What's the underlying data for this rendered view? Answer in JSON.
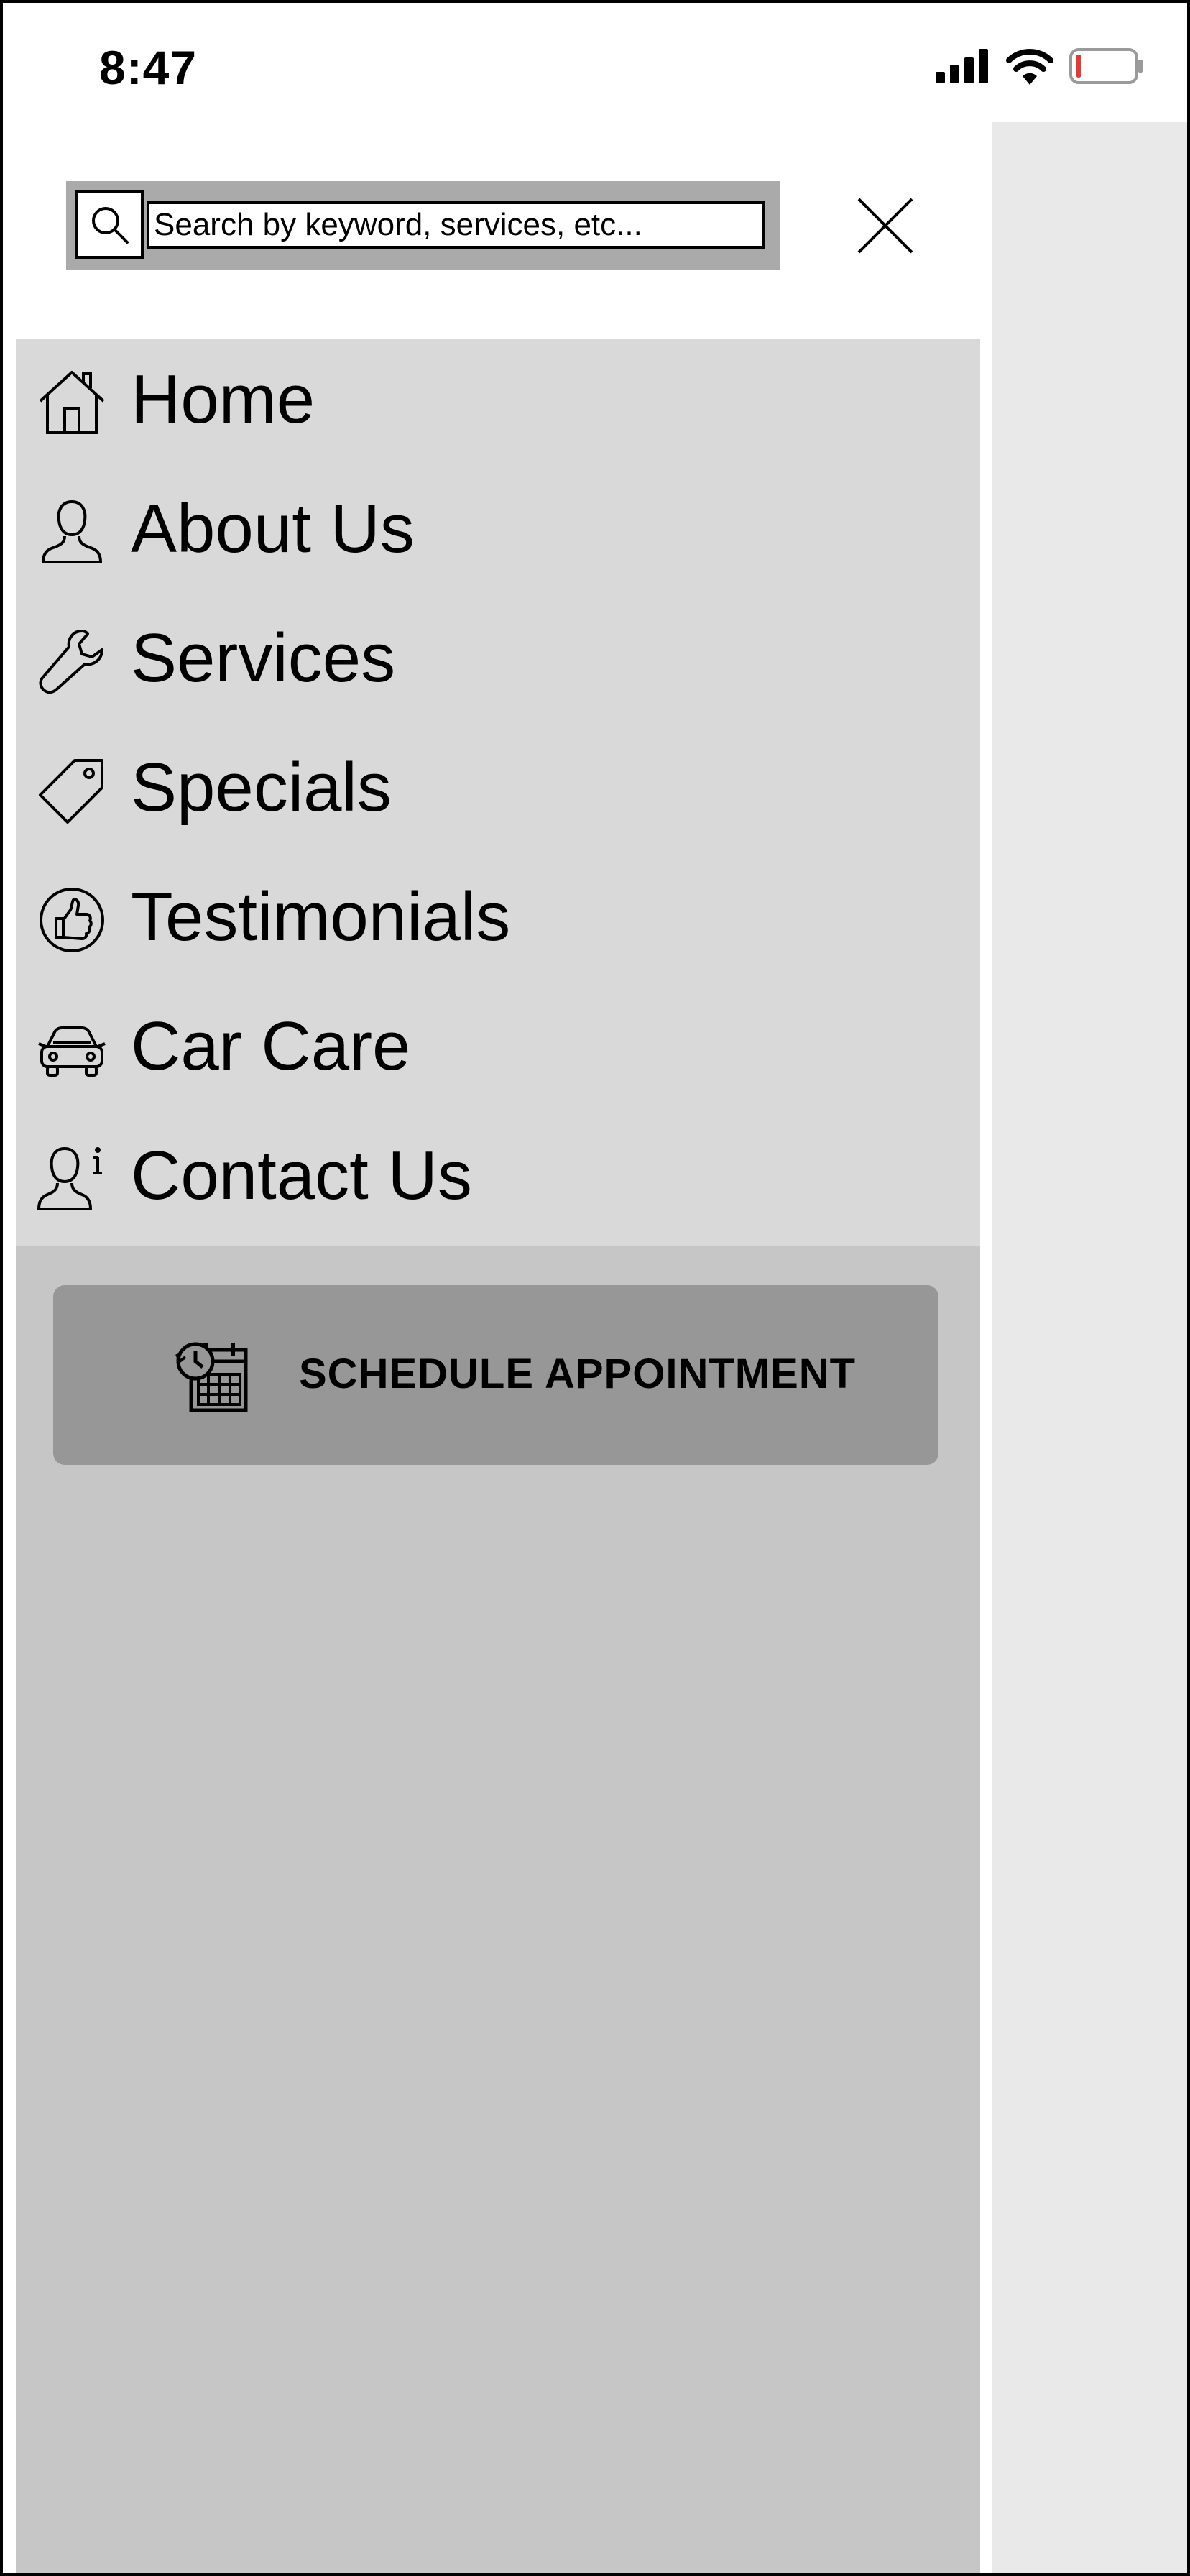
{
  "status_bar": {
    "time": "8:47",
    "icons": [
      "signal-icon",
      "wifi-icon",
      "battery-icon"
    ],
    "battery_level_fraction": 0.1,
    "battery_color": "#e53935"
  },
  "search": {
    "placeholder": "Search by keyword, services, etc...",
    "icon": "search-icon"
  },
  "close": {
    "icon": "close-icon"
  },
  "nav": {
    "items": [
      {
        "label": "Home",
        "icon": "home-icon"
      },
      {
        "label": "About Us",
        "icon": "person-icon"
      },
      {
        "label": "Services",
        "icon": "wrench-icon"
      },
      {
        "label": "Specials",
        "icon": "tag-icon"
      },
      {
        "label": "Testimonials",
        "icon": "thumbs-up-icon"
      },
      {
        "label": "Car Care",
        "icon": "car-icon"
      },
      {
        "label": "Contact Us",
        "icon": "person-info-icon"
      }
    ]
  },
  "schedule": {
    "label": "SCHEDULE APPOINTMENT",
    "icon": "calendar-clock-icon"
  },
  "colors": {
    "search_bar_bg": "#aaaaaa",
    "nav_bg": "#d9d9d9",
    "lower_panel_bg": "#c6c6c6",
    "button_bg": "#979797",
    "backdrop_bg": "#e9e9e9"
  }
}
